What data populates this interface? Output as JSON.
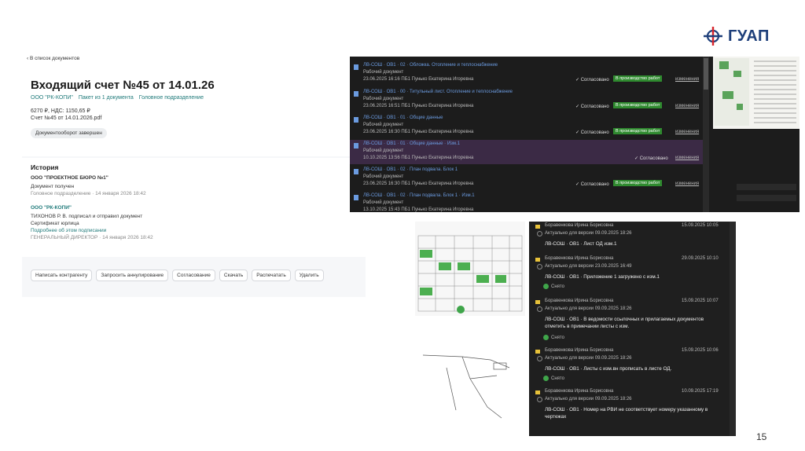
{
  "logo": {
    "text": "ГУАП"
  },
  "page_number": "15",
  "doc_panel": {
    "back_link": "‹ В список документов",
    "title": "Входящий счет №45 от 14.01.26",
    "links": [
      "ООО \"РК-КОПИ\"",
      "Пакет из 1 документа",
      "Головное подразделение"
    ],
    "amount": "6270 ₽, НДС: 1150,65 ₽",
    "file": "Счет №45 от 14.01.2026.pdf",
    "status": "Документооборот завершен",
    "history": {
      "title": "История",
      "org1": "ООО \"ПРОЕКТНОЕ БЮРО №1\"",
      "event1": "Документ получен",
      "event1_meta": "Головное подразделение · 14 января 2026 18:42",
      "org2": "ООО \"РК-КОПИ\"",
      "event2": "ТИХОНОВ Р. В. подписал и отправил документ",
      "cert": "Сертификат юрлица",
      "cert_link": "Подробнее об этом подписании",
      "signer_meta": "ГЕНЕРАЛЬНЫЙ ДИРЕКТОР · 14 января 2026 18:42"
    },
    "toolbar": [
      "Написать контрагенту",
      "Запросить аннулирование",
      "Согласование",
      "Скачать",
      "Распечатать",
      "Удалить"
    ]
  },
  "doc_list": {
    "rows": [
      {
        "title": "ЛВ-СОШ · ОВ1 · 02 · Обложка. Отопление и теплоснабжение",
        "type": "Рабочий документ",
        "meta": "23.06.2025 16:16 ПБ1 Пунько Екатерина Игоревна",
        "status": "Согласовано",
        "badge": "В производство работ",
        "changes": "изменения",
        "selected": false
      },
      {
        "title": "ЛВ-СОШ · ОВ1 · 00 · Титульный лист. Отопление и теплоснабжение",
        "type": "Рабочий документ",
        "meta": "23.06.2025 16:51 ПБ1 Пунько Екатерина Игоревна",
        "status": "Согласовано",
        "badge": "В производство работ",
        "changes": "изменения",
        "selected": false
      },
      {
        "title": "ЛВ-СОШ · ОВ1 · 01 · Общие данные",
        "type": "Рабочий документ",
        "meta": "23.06.2025 16:30 ПБ1 Пунько Екатерина Игоревна",
        "status": "Согласовано",
        "badge": "В производство работ",
        "changes": "изменения",
        "selected": false
      },
      {
        "title": "ЛВ-СОШ · ОВ1 · 01 · Общие данные · Изм.1",
        "type": "Рабочий документ",
        "meta": "10.10.2025 13:56 ПБ1 Пунько Екатерина Игоревна",
        "status": "Согласовано",
        "badge": "",
        "changes": "изменения",
        "selected": true
      },
      {
        "title": "ЛВ-СОШ · ОВ1 · 02 · План подвала. Блок 1",
        "type": "Рабочий документ",
        "meta": "23.06.2025 16:30 ПБ1 Пунько Екатерина Игоревна",
        "status": "Согласовано",
        "badge": "В производство работ",
        "changes": "изменения",
        "selected": false
      },
      {
        "title": "ЛВ-СОШ · ОВ1 · 02 · План подвала. Блок 1 · Изм.1",
        "type": "Рабочий документ",
        "meta": "13.10.2025 15:43 ПБ1 Пунько Екатерина Игоревна",
        "status": "",
        "badge": "",
        "changes": "",
        "selected": false
      }
    ]
  },
  "comments": [
    {
      "author": "Боравенкова Ирина Борисовна",
      "date": "15.09.2025 10:05",
      "version": "Актуально для версии 09.09.2025 18:26",
      "text": "ЛВ-СОШ · ОВ1 · Лист ОД изм.1",
      "removed": ""
    },
    {
      "author": "Боравенкова Ирина Борисовна",
      "date": "29.09.2025 10:10",
      "version": "Актуально для версии 23.09.2025 16:49",
      "text": "ЛВ-СОШ · ОВ1 · Приложение 1 загружено с изм.1",
      "removed": "Снято"
    },
    {
      "author": "Боравенкова Ирина Борисовна",
      "date": "15.09.2025 10:07",
      "version": "Актуально для версии 09.09.2025 18:26",
      "text": "ЛВ-СОШ · ОВ1 · В ведомости ссылочных и прилагаемых документов отметить в примечании листы с изм.",
      "removed": "Снято"
    },
    {
      "author": "Боравенкова Ирина Борисовна",
      "date": "15.09.2025 10:06",
      "version": "Актуально для версии 09.09.2025 18:26",
      "text": "ЛВ-СОШ · ОВ1 · Листы с изм.вн прописать в листе ОД.",
      "removed": "Снято"
    },
    {
      "author": "Боравенкова Ирина Борисовна",
      "date": "10.09.2025 17:19",
      "version": "Актуально для версии 09.09.2025 18:26",
      "text": "ЛВ-СОШ · ОВ1 · Номер на РВИ не соответствует номеру указанному в чертежах",
      "removed": ""
    }
  ]
}
